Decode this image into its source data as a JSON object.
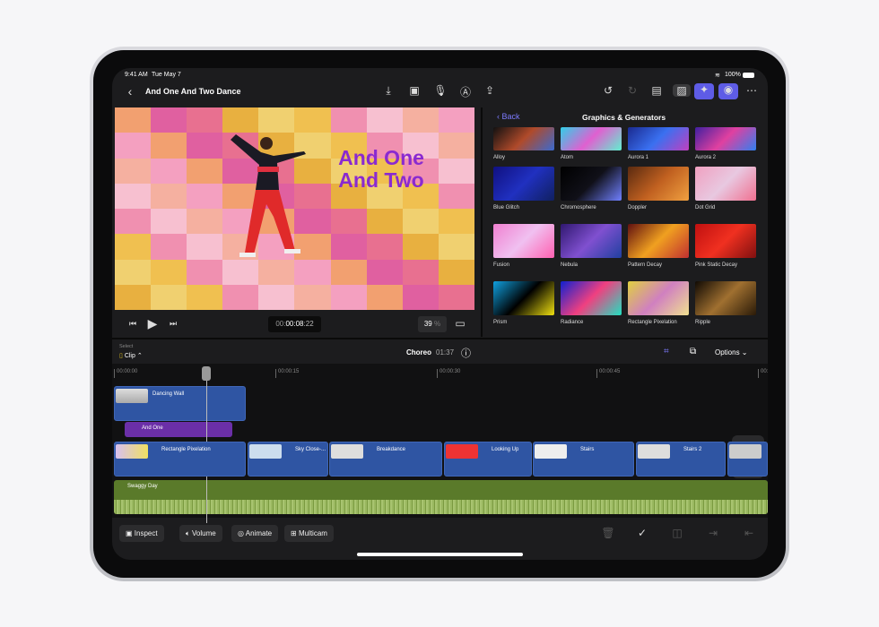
{
  "status": {
    "time": "9:41 AM",
    "date": "Tue May 7",
    "battery": "100%"
  },
  "nav": {
    "project_title": "And One And Two Dance"
  },
  "viewer": {
    "title_line1": "And One",
    "title_line2": "And Two",
    "timecode_prefix": "00:",
    "timecode_main": "00:08",
    "timecode_frames": ":22",
    "zoom_value": "39",
    "zoom_unit": "%"
  },
  "browser": {
    "back_label": "Back",
    "title": "Graphics & Generators",
    "items": [
      {
        "label": "Alloy",
        "colors": [
          "#111",
          "#b04a2a",
          "#3a6ad0"
        ]
      },
      {
        "label": "Atom",
        "colors": [
          "#30d0e8",
          "#e060d0",
          "#60f0d0"
        ]
      },
      {
        "label": "Aurora 1",
        "colors": [
          "#1a2a90",
          "#3a70f0",
          "#c040c0"
        ]
      },
      {
        "label": "Aurora 2",
        "colors": [
          "#4020a0",
          "#e040a0",
          "#3080f0"
        ]
      },
      {
        "label": "Blue Glitch",
        "colors": [
          "#101080",
          "#2030c0",
          "#102060"
        ]
      },
      {
        "label": "Chromosphere",
        "colors": [
          "#000",
          "#101018",
          "#7080ff"
        ]
      },
      {
        "label": "Doppler",
        "colors": [
          "#5a2a10",
          "#c06020",
          "#f0a040"
        ]
      },
      {
        "label": "Dot Grid",
        "colors": [
          "#f0a0c0",
          "#e8c8e0",
          "#f07090"
        ]
      },
      {
        "label": "Fusion",
        "colors": [
          "#f080d0",
          "#f0c0f0",
          "#ff60b0"
        ]
      },
      {
        "label": "Nebula",
        "colors": [
          "#301870",
          "#8050d0",
          "#2040a0"
        ]
      },
      {
        "label": "Pattern Decay",
        "colors": [
          "#601010",
          "#f0a020",
          "#c03030"
        ]
      },
      {
        "label": "Pink Static Decay",
        "colors": [
          "#c01010",
          "#f03020",
          "#801010"
        ]
      },
      {
        "label": "Prism",
        "colors": [
          "#10a0e0",
          "#000",
          "#f0e010"
        ]
      },
      {
        "label": "Radiance",
        "colors": [
          "#1020d0",
          "#f04080",
          "#20e0c0"
        ]
      },
      {
        "label": "Rectangle Pixelation",
        "colors": [
          "#e0d040",
          "#d080c0",
          "#f0e090"
        ]
      },
      {
        "label": "Ripple",
        "colors": [
          "#100a04",
          "#a07030",
          "#2a1a08"
        ]
      }
    ]
  },
  "timeline": {
    "select_label": "Select",
    "mode": "Clip",
    "project_name": "Choreo",
    "duration": "01:37",
    "options_label": "Options",
    "ruler": [
      "00:00:00",
      "00:00:15",
      "00:00:30",
      "00:00:45",
      "00:0"
    ],
    "connected_clips": [
      {
        "label": "Dancing Wall"
      },
      {
        "label": "And One"
      }
    ],
    "primary_clips": [
      {
        "label": "Rectangle Pixelation"
      },
      {
        "label": "Sky Close-..."
      },
      {
        "label": "Breakdance"
      },
      {
        "label": "Looking Up"
      },
      {
        "label": "Stairs"
      },
      {
        "label": "Stairs 2"
      }
    ],
    "audio_clip": "Swaggy Day"
  },
  "toolbar": {
    "inspect": "Inspect",
    "volume": "Volume",
    "animate": "Animate",
    "multicam": "Multicam"
  },
  "colors": {
    "accent": "#5e5ce6",
    "video_clip": "#2f55a3",
    "title_clip": "#6b2fa8",
    "audio_clip": "#5a7a2a"
  }
}
